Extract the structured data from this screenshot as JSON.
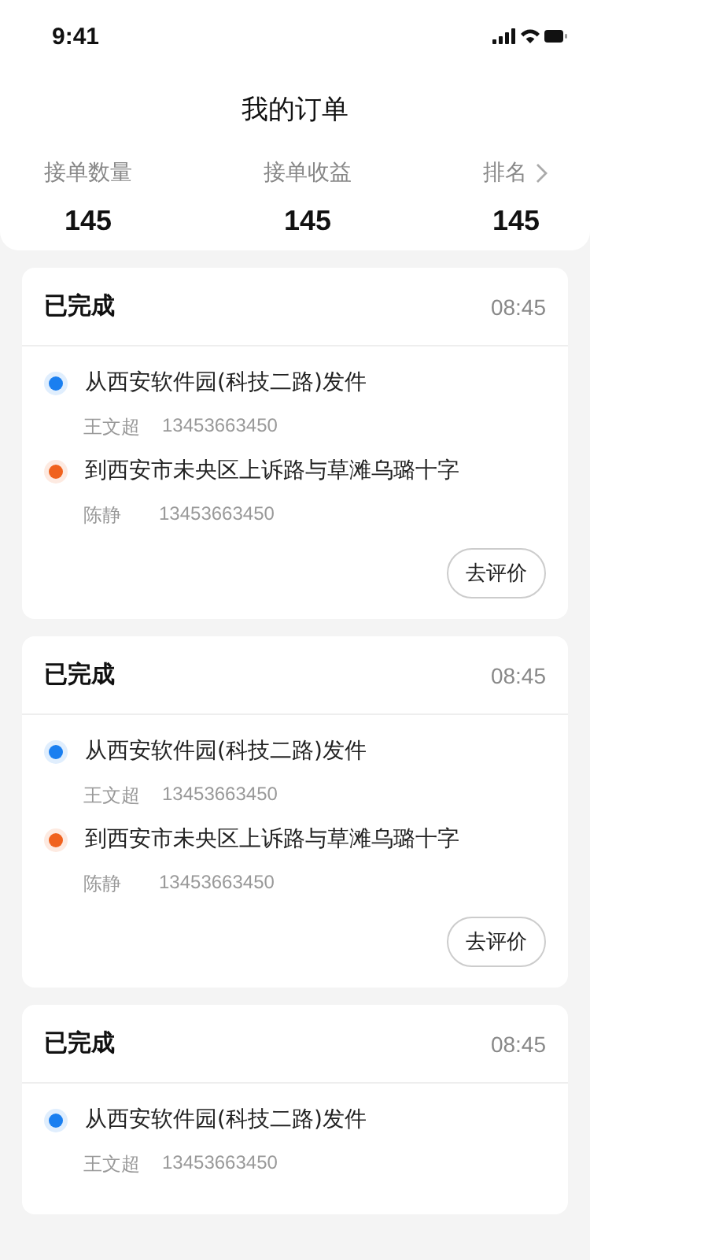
{
  "status_bar": {
    "time": "9:41"
  },
  "title": "我的订单",
  "stats": [
    {
      "label": "接单数量",
      "value": "145",
      "link": false
    },
    {
      "label": "接单收益",
      "value": "145",
      "link": false
    },
    {
      "label": "排名",
      "value": "145",
      "link": true
    }
  ],
  "orders": [
    {
      "status": "已完成",
      "time": "08:45",
      "stops": [
        {
          "address": "从西安软件园(科技二路)发件",
          "name": "王文超",
          "phone": "13453663450",
          "color": "#1a7ff0"
        },
        {
          "address": "到西安市未央区上诉路与草滩乌璐十字",
          "name": "陈静",
          "phone": "13453663450",
          "color": "#f0621e"
        }
      ],
      "button": "去评价"
    },
    {
      "status": "已完成",
      "time": "08:45",
      "stops": [
        {
          "address": "从西安软件园(科技二路)发件",
          "name": "王文超",
          "phone": "13453663450",
          "color": "#1a7ff0"
        },
        {
          "address": "到西安市未央区上诉路与草滩乌璐十字",
          "name": "陈静",
          "phone": "13453663450",
          "color": "#f0621e"
        }
      ],
      "button": "去评价"
    },
    {
      "status": "已完成",
      "time": "08:45",
      "stops": [
        {
          "address": "从西安软件园(科技二路)发件",
          "name": "王文超",
          "phone": "13453663450",
          "color": "#1a7ff0"
        }
      ]
    }
  ]
}
